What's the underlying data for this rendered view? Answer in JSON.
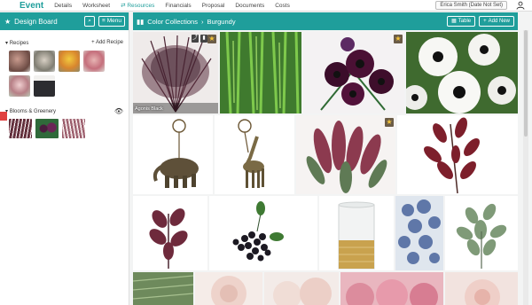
{
  "nav": {
    "brand": "Event",
    "items": [
      "Details",
      "Worksheet",
      "Resources",
      "Financials",
      "Proposal",
      "Documents",
      "Costs"
    ],
    "active": "Resources",
    "user": "Erica Smith (Date Not Set)"
  },
  "design_board": {
    "title": "Design Board",
    "menu_label": "Menu",
    "recipes_label": "Recipes",
    "add_recipe_label": "Add Recipe",
    "blooms_label": "Blooms & Greenery"
  },
  "main": {
    "crumb_root": "Color Collections",
    "crumb_current": "Burgundy",
    "table_label": "Table",
    "add_new_label": "Add New",
    "first_tile_caption": "Agonis Black"
  },
  "icons": {
    "star": "star-icon",
    "search": "search-icon",
    "menu": "menu-icon",
    "eye": "eye-icon",
    "book": "book-icon",
    "user": "user-icon"
  },
  "colors": {
    "accent": "#1f9e9b",
    "favorite": "#f4c338",
    "alert": "#e0403f"
  }
}
